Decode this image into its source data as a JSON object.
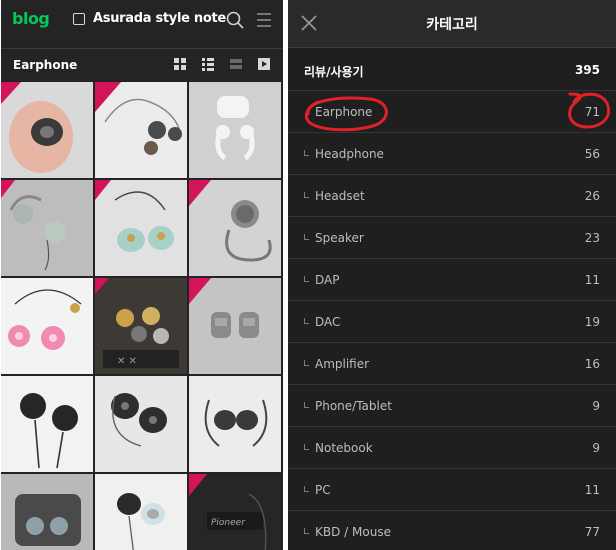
{
  "left": {
    "logo": "blog",
    "blog_title": "Asurada style note",
    "category_title": "Earphone",
    "icons": [
      "search-icon",
      "hamburger-menu-icon",
      "grid-view-icon",
      "list-view-icon",
      "card-view-icon",
      "play-icon"
    ]
  },
  "right": {
    "title": "카테고리",
    "categories": [
      {
        "label": "리뷰/사용기",
        "count": "395"
      },
      {
        "label": "Earphone",
        "count": "71"
      },
      {
        "label": "Headphone",
        "count": "56"
      },
      {
        "label": "Headset",
        "count": "26"
      },
      {
        "label": "Speaker",
        "count": "23"
      },
      {
        "label": "DAP",
        "count": "11"
      },
      {
        "label": "DAC",
        "count": "19"
      },
      {
        "label": "Amplifier",
        "count": "16"
      },
      {
        "label": "Phone/Tablet",
        "count": "9"
      },
      {
        "label": "Notebook",
        "count": "9"
      },
      {
        "label": "PC",
        "count": "11"
      },
      {
        "label": "KBD / Mouse",
        "count": "77"
      }
    ],
    "highlight_color": "#e0202a"
  }
}
